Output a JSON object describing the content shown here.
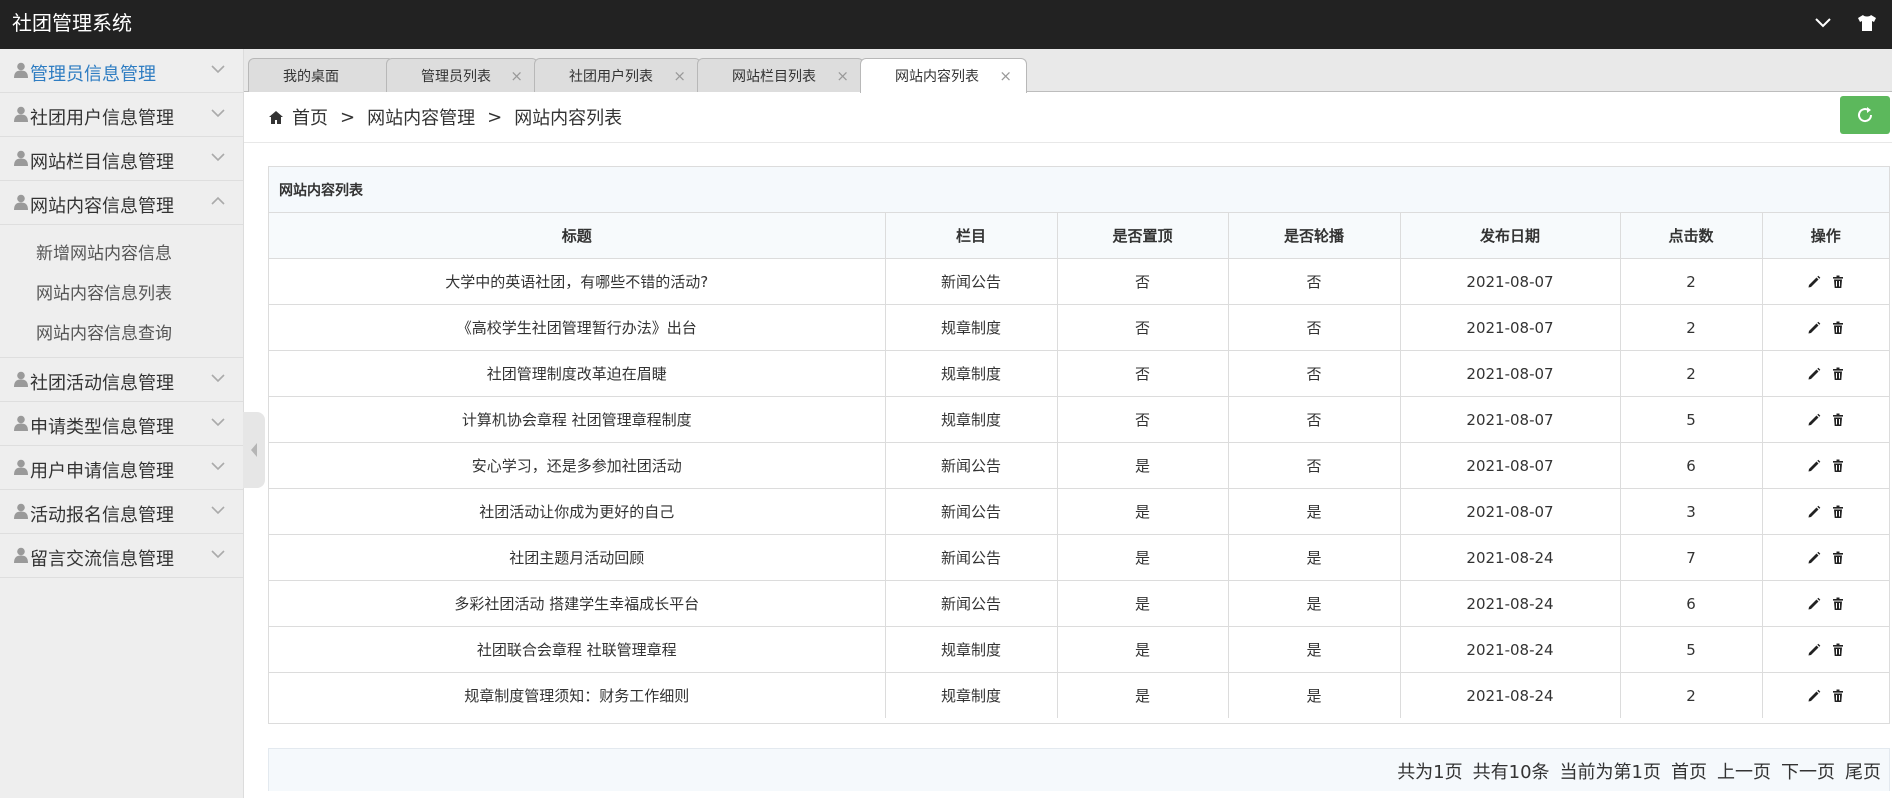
{
  "app": {
    "title": "社团管理系统"
  },
  "topbar": {
    "icons": [
      "chevron-down-icon",
      "shirt-icon"
    ]
  },
  "sidebar": {
    "items": [
      {
        "label": "管理员信息管理",
        "active": true
      },
      {
        "label": "社团用户信息管理"
      },
      {
        "label": "网站栏目信息管理"
      },
      {
        "label": "网站内容信息管理",
        "expanded": true,
        "children": [
          "新增网站内容信息",
          "网站内容信息列表",
          "网站内容信息查询"
        ]
      },
      {
        "label": "社团活动信息管理"
      },
      {
        "label": "申请类型信息管理"
      },
      {
        "label": "用户申请信息管理"
      },
      {
        "label": "活动报名信息管理"
      },
      {
        "label": "留言交流信息管理"
      }
    ]
  },
  "tabs": [
    {
      "label": "我的桌面",
      "closable": false
    },
    {
      "label": "管理员列表",
      "closable": true
    },
    {
      "label": "社团用户列表",
      "closable": true
    },
    {
      "label": "网站栏目列表",
      "closable": true
    },
    {
      "label": "网站内容列表",
      "closable": true,
      "active": true
    }
  ],
  "breadcrumb": {
    "home": "首页",
    "level1": "网站内容管理",
    "level2": "网站内容列表",
    "separator": ">"
  },
  "panel": {
    "title": "网站内容列表",
    "columns": [
      "标题",
      "栏目",
      "是否置顶",
      "是否轮播",
      "发布日期",
      "点击数",
      "操作"
    ],
    "rows": [
      {
        "title": "大学中的英语社团，有哪些不错的活动?",
        "category": "新闻公告",
        "top": "否",
        "carousel": "否",
        "date": "2021-08-07",
        "clicks": "2"
      },
      {
        "title": "《高校学生社团管理暂行办法》出台",
        "category": "规章制度",
        "top": "否",
        "carousel": "否",
        "date": "2021-08-07",
        "clicks": "2"
      },
      {
        "title": "社团管理制度改革迫在眉睫",
        "category": "规章制度",
        "top": "否",
        "carousel": "否",
        "date": "2021-08-07",
        "clicks": "2"
      },
      {
        "title": "计算机协会章程 社团管理章程制度",
        "category": "规章制度",
        "top": "否",
        "carousel": "否",
        "date": "2021-08-07",
        "clicks": "5"
      },
      {
        "title": "安心学习，还是多参加社团活动",
        "category": "新闻公告",
        "top": "是",
        "carousel": "否",
        "date": "2021-08-07",
        "clicks": "6"
      },
      {
        "title": "社团活动让你成为更好的自己",
        "category": "新闻公告",
        "top": "是",
        "carousel": "是",
        "date": "2021-08-07",
        "clicks": "3"
      },
      {
        "title": "社团主题月活动回顾",
        "category": "新闻公告",
        "top": "是",
        "carousel": "是",
        "date": "2021-08-24",
        "clicks": "7"
      },
      {
        "title": "多彩社团活动 搭建学生幸福成长平台",
        "category": "新闻公告",
        "top": "是",
        "carousel": "是",
        "date": "2021-08-24",
        "clicks": "6"
      },
      {
        "title": "社团联合会章程 社联管理章程",
        "category": "规章制度",
        "top": "是",
        "carousel": "是",
        "date": "2021-08-24",
        "clicks": "5"
      },
      {
        "title": "规章制度管理须知：财务工作细则",
        "category": "规章制度",
        "top": "是",
        "carousel": "是",
        "date": "2021-08-24",
        "clicks": "2"
      }
    ]
  },
  "pager": {
    "total_pages": "共为1页",
    "total_rows": "共有10条",
    "current": "当前为第1页",
    "first": "首页",
    "prev": "上一页",
    "next": "下一页",
    "last": "尾页"
  },
  "colors": {
    "topbar": "#222222",
    "sidebar": "#eeeeee",
    "accent_link": "#2f7dc2",
    "refresh": "#5cb85c",
    "table_header": "#f7fafc"
  }
}
